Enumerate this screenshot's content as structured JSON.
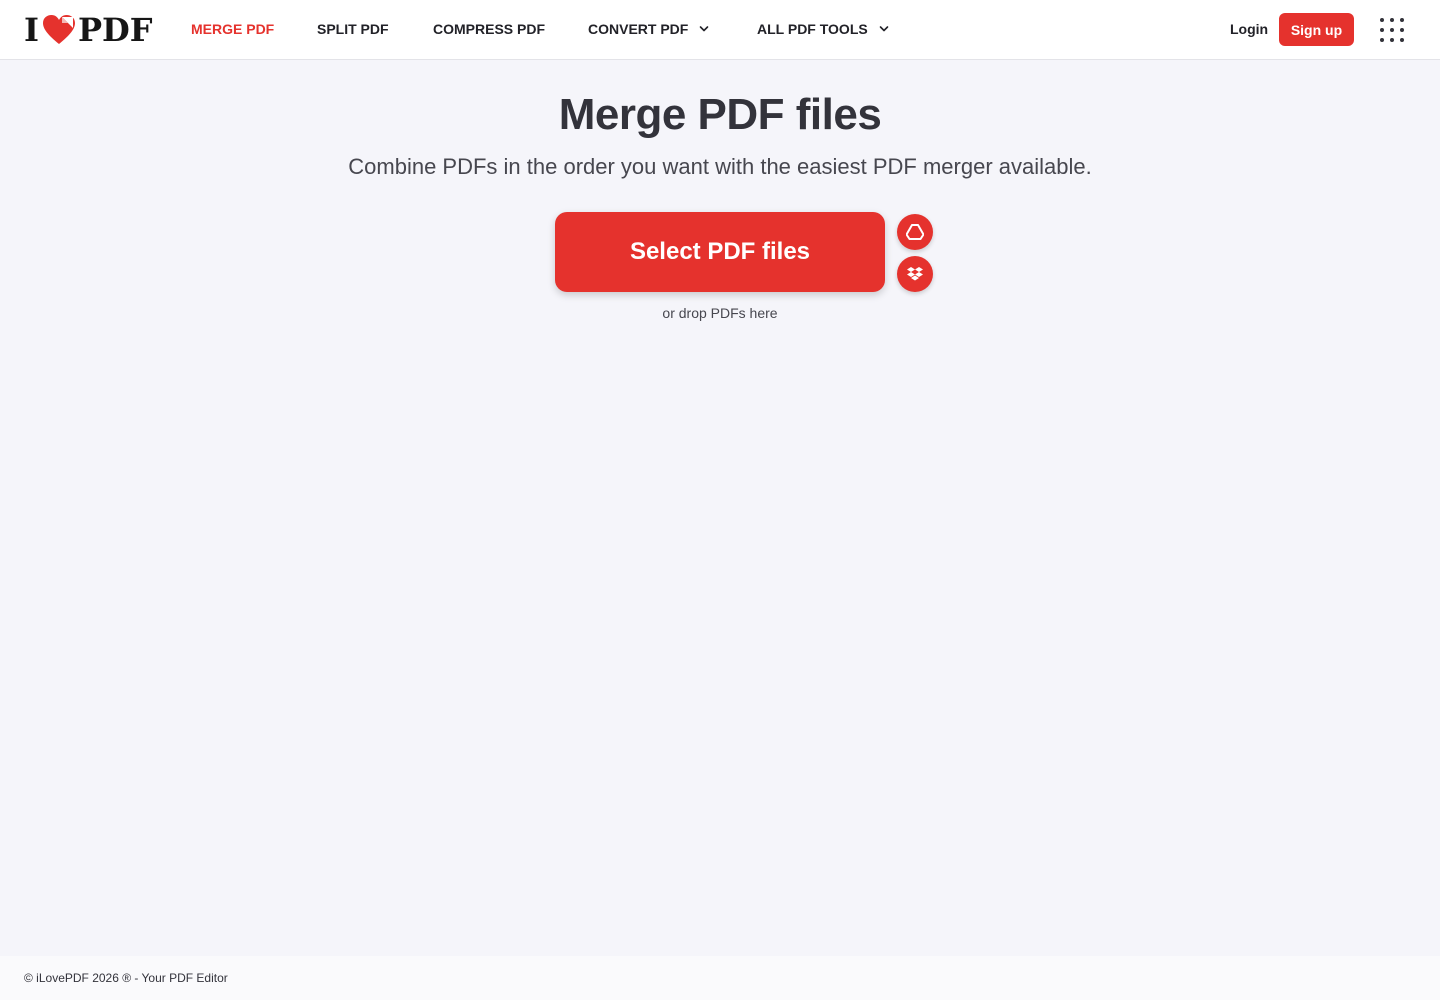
{
  "brand": {
    "logo_left": "I",
    "logo_right": "PDF",
    "accent_color": "#e5322d"
  },
  "nav": {
    "items": [
      {
        "label": "MERGE PDF",
        "active": true
      },
      {
        "label": "SPLIT PDF"
      },
      {
        "label": "COMPRESS PDF"
      },
      {
        "label": "CONVERT PDF",
        "dropdown": true
      },
      {
        "label": "ALL PDF TOOLS",
        "dropdown": true
      }
    ],
    "login_label": "Login",
    "signup_label": "Sign up",
    "apps_icon": "apps-grid-icon"
  },
  "main": {
    "title": "Merge PDF files",
    "subtitle": "Combine PDFs in the order you want with the easiest PDF merger available.",
    "select_button_label": "Select PDF files",
    "drop_hint": "or drop PDFs here",
    "cloud_sources": [
      "google-drive-icon",
      "dropbox-icon"
    ]
  },
  "footer": {
    "copyright": "© iLovePDF 2026 ® - Your PDF Editor"
  }
}
